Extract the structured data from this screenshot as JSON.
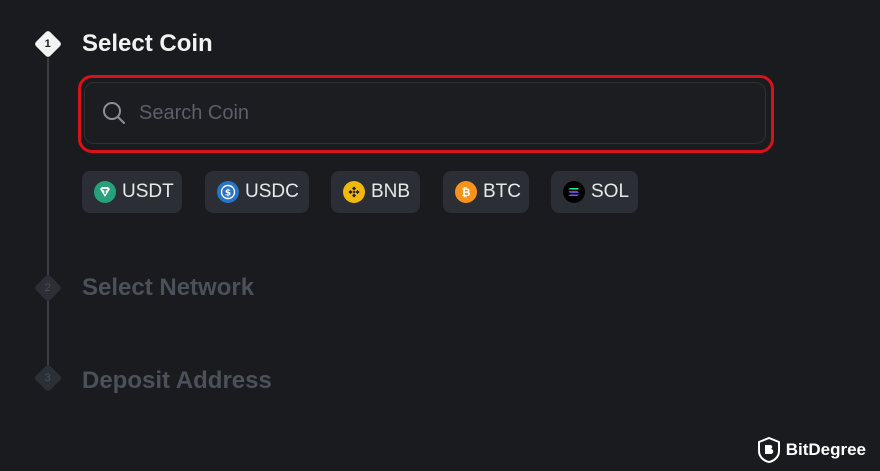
{
  "steps": [
    {
      "number": "1",
      "title": "Select Coin",
      "state": "active"
    },
    {
      "number": "2",
      "title": "Select Network",
      "state": "inactive"
    },
    {
      "number": "3",
      "title": "Deposit Address",
      "state": "inactive"
    }
  ],
  "search": {
    "placeholder": "Search Coin",
    "value": ""
  },
  "coins": [
    {
      "symbol": "USDT",
      "icon": "usdt-icon",
      "color": "#26a17b"
    },
    {
      "symbol": "USDC",
      "icon": "usdc-icon",
      "color": "#2775ca"
    },
    {
      "symbol": "BNB",
      "icon": "bnb-icon",
      "color": "#f0b90b"
    },
    {
      "symbol": "BTC",
      "icon": "btc-icon",
      "color": "#f7931a"
    },
    {
      "symbol": "SOL",
      "icon": "sol-icon",
      "color": "#000000"
    }
  ],
  "colors": {
    "background": "#1a1b1f",
    "chip_background": "#2b2e35",
    "highlight": "#d8111b",
    "active_text": "#f2f2f2",
    "inactive_text": "#4b5059"
  },
  "watermark": {
    "text": "BitDegree"
  }
}
